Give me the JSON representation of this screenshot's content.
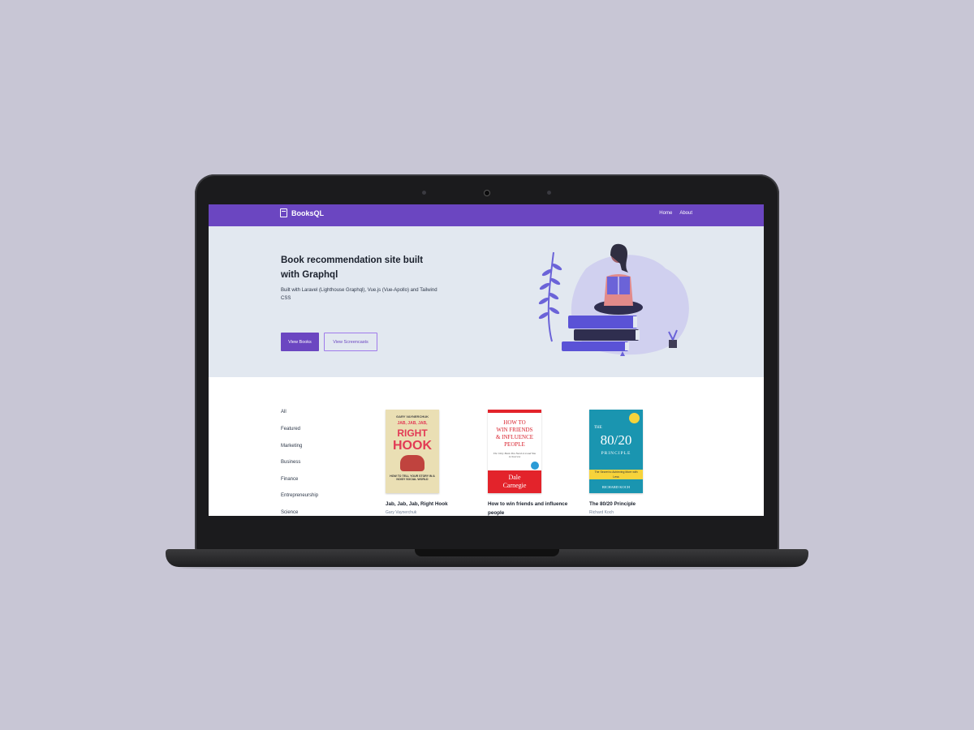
{
  "nav": {
    "brand": "BooksQL",
    "links": [
      "Home",
      "About"
    ]
  },
  "hero": {
    "title": "Book recommendation site built with Graphql",
    "subtitle": "Built with Laravel (Lighthouse Graphql), Vue.js (Vue-Apollo) and Tailwind CSS",
    "primary_button": "View Books",
    "secondary_button": "View Screencasts"
  },
  "categories": [
    "All",
    "Featured",
    "Marketing",
    "Business",
    "Finance",
    "Entrepreneurship",
    "Science"
  ],
  "books": [
    {
      "title": "Jab, Jab, Jab, Right Hook",
      "author": "Gary Vaynerchuk",
      "cover_lines": [
        "GARY VAYNERCHUK",
        "JAB, JAB, JAB,",
        "RIGHT",
        "HOOK",
        "HOW TO TELL YOUR STORY IN A NOISY SOCIAL WORLD"
      ]
    },
    {
      "title": "How to win friends and influence people",
      "author": "",
      "cover_lines": [
        "HOW TO",
        "WIN FRIENDS",
        "& INFLUENCE",
        "PEOPLE",
        "The Only Book You Need to Lead You to Success",
        "Dale",
        "Carnegie"
      ]
    },
    {
      "title": "The 80/20 Principle",
      "author": "Richard Koch",
      "cover_lines": [
        "THE",
        "80/20",
        "PRINCIPLE",
        "The Secret to Achieving More with Less",
        "RICHARD KOCH"
      ]
    }
  ],
  "colors": {
    "accent": "#6b46c1",
    "hero_bg": "#e2e8f0",
    "page_bg": "#c8c6d5"
  }
}
